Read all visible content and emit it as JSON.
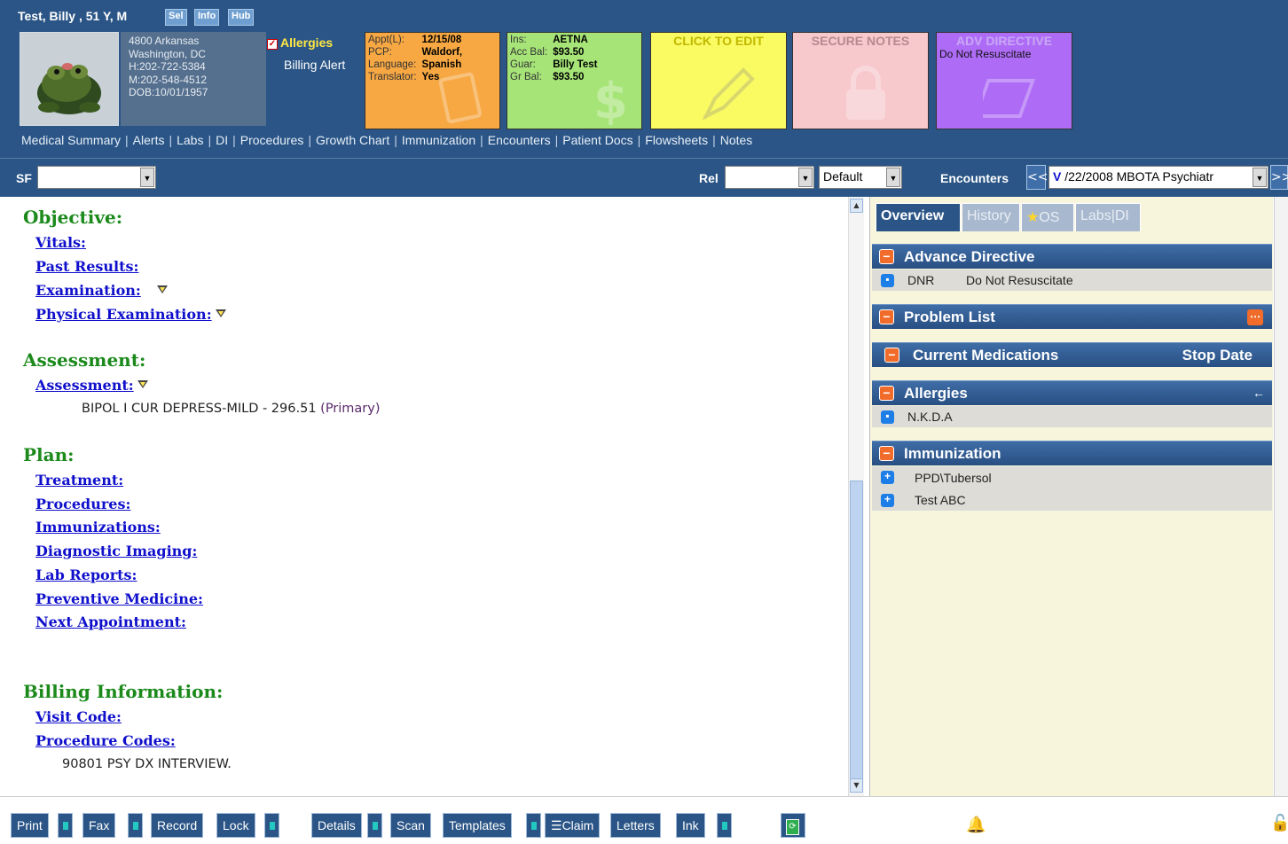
{
  "patient": {
    "name": "Test, Billy , 51 Y, M",
    "buttons": [
      "Sel",
      "Info",
      "Hub"
    ],
    "address": [
      "4800 Arkansas",
      "Washington, DC",
      "H:202-722-5384",
      "M:202-548-4512",
      "DOB:10/01/1957"
    ],
    "allergies_label": "Allergies",
    "billing_alert": "Billing Alert"
  },
  "tiles": {
    "appt": {
      "rows": [
        [
          "Appt(L):",
          "12/15/08"
        ],
        [
          "PCP:",
          "Waldorf,"
        ],
        [
          "Language:",
          "Spanish"
        ],
        [
          "Translator:",
          "Yes"
        ]
      ]
    },
    "ins": {
      "rows": [
        [
          "Ins:",
          "AETNA"
        ],
        [
          "Acc Bal:",
          "$93.50"
        ],
        [
          "Guar:",
          "Billy Test"
        ],
        [
          "Gr Bal:",
          "$93.50"
        ]
      ]
    },
    "edit": {
      "title": "CLICK TO EDIT"
    },
    "secure": {
      "title": "SECURE NOTES"
    },
    "adv": {
      "title": "ADV DIRECTIVE",
      "sub": "Do Not Resuscitate"
    }
  },
  "nav": [
    "Medical Summary",
    "Alerts",
    "Labs",
    "DI",
    "Procedures",
    "Growth Chart",
    "Immunization",
    "Encounters",
    "Patient Docs",
    "Flowsheets",
    "Notes"
  ],
  "filter": {
    "sf_label": "SF",
    "sf_value": "",
    "rel_label": "Rel",
    "rel_value": "",
    "default_value": "Default",
    "encounters_label": "Encounters",
    "prev": "<<",
    "enc_v": "V",
    "enc_value": "/22/2008 MBOTA Psychiatr",
    "next": ">>"
  },
  "note": {
    "objective": "Objective:",
    "vitals": "Vitals:",
    "past_results": "Past Results:",
    "examination": "Examination:",
    "physical_exam": "Physical Examination:",
    "assessment_h": "Assessment:",
    "assessment": "Assessment:",
    "dx": "BIPOL I CUR DEPRESS-MILD - 296.51",
    "dx_primary": "(Primary)",
    "plan": "Plan:",
    "treatment": "Treatment:",
    "procedures": "Procedures:",
    "immunizations": "Immunizations:",
    "diagnostic_imaging": "Diagnostic Imaging:",
    "lab_reports": "Lab Reports:",
    "preventive": "Preventive Medicine:",
    "next_appt": "Next Appointment:",
    "billing_h": "Billing Information:",
    "visit_code": "Visit Code:",
    "procedure_codes": "Procedure Codes:",
    "proc_line": "90801 PSY DX INTERVIEW."
  },
  "rpanel": {
    "tabs": [
      "Overview",
      "History",
      "OS",
      "Labs|DI"
    ],
    "adv_h": "Advance Directive",
    "adv_row_k": "DNR",
    "adv_row_v": "Do Not Resuscitate",
    "problem_h": "Problem List",
    "meds_h": "Current Medications",
    "meds_stop": "Stop Date",
    "allergies_h": "Allergies",
    "allergy_row": "N.K.D.A",
    "immun_h": "Immunization",
    "immun_rows": [
      "PPD\\Tubersol",
      "Test ABC"
    ]
  },
  "bottom": {
    "buttons": [
      "Print",
      "Fax",
      "Record",
      "Lock",
      "Details",
      "Scan",
      "Templates",
      "Claim",
      "Letters",
      "Ink"
    ]
  }
}
